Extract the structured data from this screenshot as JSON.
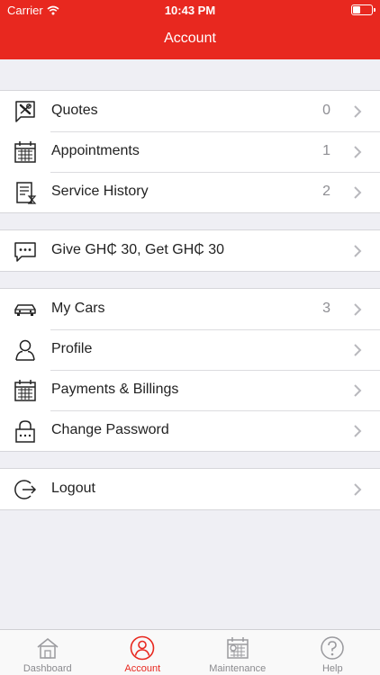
{
  "status": {
    "carrier": "Carrier",
    "time": "10:43 PM"
  },
  "nav": {
    "title": "Account"
  },
  "groups": [
    {
      "rows": [
        {
          "label": "Quotes",
          "count": "0",
          "icon": "quote-tools-icon"
        },
        {
          "label": "Appointments",
          "count": "1",
          "icon": "calendar-icon"
        },
        {
          "label": "Service History",
          "count": "2",
          "icon": "document-history-icon"
        }
      ]
    },
    {
      "rows": [
        {
          "label": "Give GH₵ 30, Get GH₵ 30",
          "count": "",
          "icon": "chat-bubble-icon"
        }
      ]
    },
    {
      "rows": [
        {
          "label": "My Cars",
          "count": "3",
          "icon": "car-icon"
        },
        {
          "label": "Profile",
          "count": "",
          "icon": "person-icon"
        },
        {
          "label": "Payments & Billings",
          "count": "",
          "icon": "calendar-icon"
        },
        {
          "label": "Change Password",
          "count": "",
          "icon": "lock-icon"
        }
      ]
    },
    {
      "rows": [
        {
          "label": "Logout",
          "count": "",
          "icon": "logout-icon"
        }
      ]
    }
  ],
  "tabs": [
    {
      "label": "Dashboard",
      "icon": "house-icon",
      "active": false
    },
    {
      "label": "Account",
      "icon": "account-icon",
      "active": true
    },
    {
      "label": "Maintenance",
      "icon": "maintenance-calendar-icon",
      "active": false
    },
    {
      "label": "Help",
      "icon": "help-icon",
      "active": false
    }
  ],
  "colors": {
    "brand": "#e8281f",
    "background": "#efeff4",
    "inactive_tab": "#8a8a8e"
  }
}
